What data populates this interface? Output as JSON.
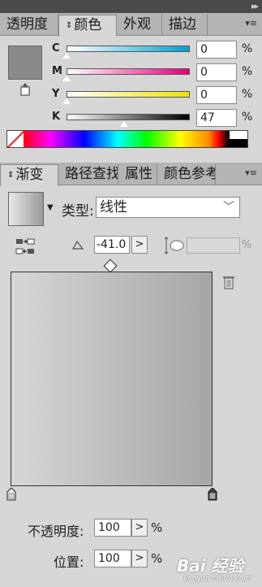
{
  "panel_tabs_top": [
    {
      "label": "透明度"
    },
    {
      "label": "颜色"
    },
    {
      "label": "外观"
    },
    {
      "label": "描边"
    }
  ],
  "color": {
    "sliders": [
      {
        "label": "C",
        "value": "0",
        "unit": "%",
        "level": 0,
        "gradient": "linear-gradient(to right,#fff,#00a0d0)"
      },
      {
        "label": "M",
        "value": "0",
        "unit": "%",
        "level": 0,
        "gradient": "linear-gradient(to right,#fff,#e0007a)"
      },
      {
        "label": "Y",
        "value": "0",
        "unit": "%",
        "level": 0,
        "gradient": "linear-gradient(to right,#fff,#f0e000)"
      },
      {
        "label": "K",
        "value": "47",
        "unit": "%",
        "level": 47,
        "gradient": "linear-gradient(to right,#fff,#000)"
      }
    ],
    "fill_color": "#8a8a8a"
  },
  "panel_tabs_bottom": [
    {
      "label": "渐变"
    },
    {
      "label": "路径查找器"
    },
    {
      "label": "属性"
    },
    {
      "label": "颜色参考"
    }
  ],
  "gradient": {
    "type_label": "类型:",
    "type_value": "线性",
    "angle_value": "-41.0",
    "angle_btn": ">",
    "aspect_unit": "%",
    "start_color": "#d6d6d6",
    "end_color": "#a6a6a6",
    "opacity_label": "不透明度:",
    "opacity_value": "100",
    "position_label": "位置:",
    "position_value": "100",
    "btn_arrow": ">",
    "unit": "%"
  },
  "watermark": {
    "main": "Bai 经验",
    "sub": "jingyan.baidu.com"
  }
}
